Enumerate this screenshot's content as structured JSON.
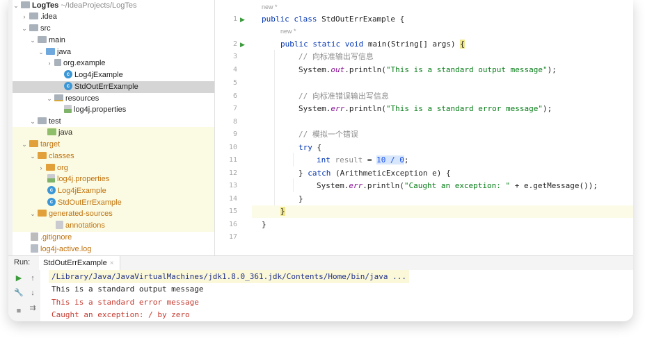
{
  "project": {
    "name": "LogTes",
    "path": "~/IdeaProjects/LogTes",
    "tree": [
      {
        "label": "LogTes",
        "kind": "project"
      },
      {
        "label": ".idea",
        "kind": "folder-grey"
      },
      {
        "label": "src",
        "kind": "folder-grey"
      },
      {
        "label": "main",
        "kind": "folder-grey"
      },
      {
        "label": "java",
        "kind": "folder-blue"
      },
      {
        "label": "org.example",
        "kind": "package"
      },
      {
        "label": "Log4jExample",
        "kind": "class"
      },
      {
        "label": "StdOutErrExample",
        "kind": "class"
      },
      {
        "label": "resources",
        "kind": "folder-res"
      },
      {
        "label": "log4j.properties",
        "kind": "props"
      },
      {
        "label": "test",
        "kind": "folder-grey"
      },
      {
        "label": "java",
        "kind": "folder-green"
      },
      {
        "label": "target",
        "kind": "folder-orange"
      },
      {
        "label": "classes",
        "kind": "folder-orange"
      },
      {
        "label": "org",
        "kind": "folder-orange"
      },
      {
        "label": "log4j.properties",
        "kind": "props"
      },
      {
        "label": "Log4jExample",
        "kind": "class"
      },
      {
        "label": "StdOutErrExample",
        "kind": "class"
      },
      {
        "label": "generated-sources",
        "kind": "folder-orange"
      },
      {
        "label": "annotations",
        "kind": "file"
      },
      {
        "label": ".gitignore",
        "kind": "git"
      },
      {
        "label": "log4j-active.log",
        "kind": "log"
      }
    ]
  },
  "editor": {
    "hint_new": "new *",
    "line_numbers": [
      "1",
      "2",
      "3",
      "4",
      "5",
      "6",
      "7",
      "8",
      "9",
      "10",
      "11",
      "12",
      "13",
      "14",
      "15",
      "16",
      "17"
    ],
    "lines": {
      "l1_kw": "public class ",
      "l1_name": "StdOutErrExample {",
      "l2_kw": "public static void ",
      "l2_rest": "main(String[] args) ",
      "l2_brace": "{",
      "l3_comment": "// 向标准输出写信息",
      "l4_pre": "System.",
      "l4_field": "out",
      "l4_mid": ".println(",
      "l4_str": "\"This is a standard output message\"",
      "l4_end": ");",
      "l6_comment": "// 向标准错误输出写信息",
      "l7_pre": "System.",
      "l7_field": "err",
      "l7_mid": ".println(",
      "l7_str": "\"This is a standard error message\"",
      "l7_end": ");",
      "l9_comment": "// 模拟一个错误",
      "l10_kw": "try",
      "l10_rest": " {",
      "l11_kw": "int ",
      "l11_var": "result",
      "l11_eq": " = ",
      "l11_expr": "10 / 0",
      "l11_end": ";",
      "l12_pre": "} ",
      "l12_kw": "catch",
      "l12_rest": " (ArithmeticException e) {",
      "l13_pre": "System.",
      "l13_field": "err",
      "l13_mid": ".println(",
      "l13_str": "\"Caught an exception: \"",
      "l13_end": " + e.getMessage());",
      "l14": "}",
      "l15": "}",
      "l16": "}"
    }
  },
  "run": {
    "label": "Run:",
    "tab": "StdOutErrExample",
    "command": "/Library/Java/JavaVirtualMachines/jdk1.8.0_361.jdk/Contents/Home/bin/java ...",
    "out1": "This is a standard output message",
    "err1": "This is a standard error message",
    "err2": "Caught an exception: / by zero"
  },
  "colors": {
    "keyword": "#0033b3",
    "string": "#067d17",
    "comment": "#8c8c8c",
    "field": "#871094",
    "error_text": "#c43b30"
  }
}
